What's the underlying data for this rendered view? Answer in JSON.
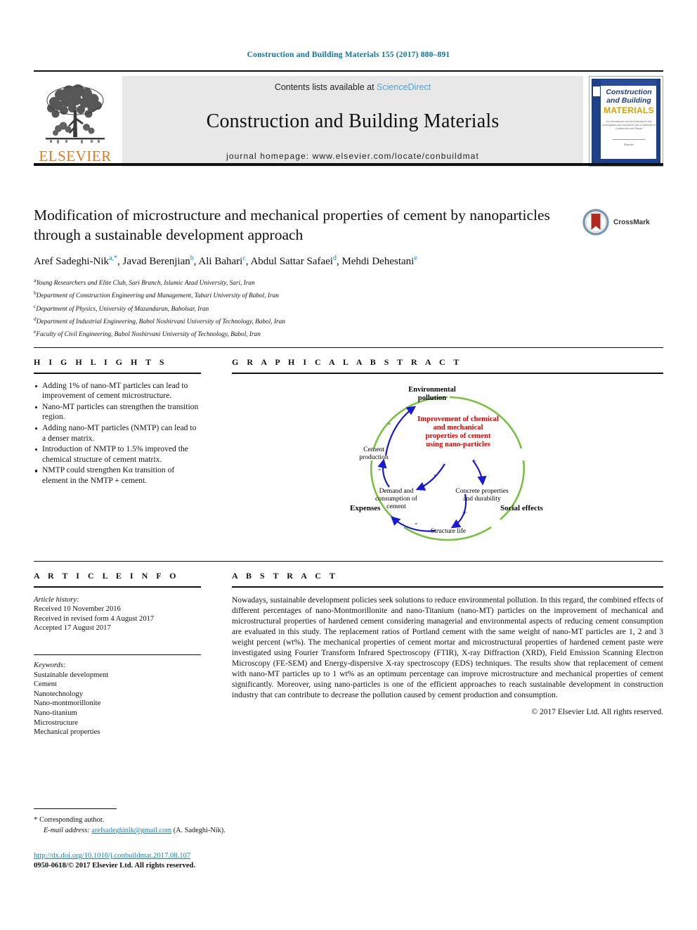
{
  "running_head": "Construction and Building Materials 155 (2017) 880–891",
  "masthead": {
    "elsevier_wordmark": "ELSEVIER",
    "contents_prefix": "Contents lists available at ",
    "sciencedirect": "ScienceDirect",
    "journal_title": "Construction and Building Materials",
    "homepage": "journal homepage: www.elsevier.com/locate/conbuildmat",
    "cover": {
      "line1": "Construction",
      "line2": "and Building",
      "line3": "MATERIALS",
      "blurb": "An International Journal Dedicated to the Investigation and Innovative Use of Materials in Construction and Repair",
      "foot": "Elsevier"
    }
  },
  "article": {
    "title": "Modification of microstructure and mechanical properties of cement by nanoparticles through a sustainable development approach",
    "authors": [
      {
        "name": "Aref Sadeghi-Nik",
        "marks": "a,*"
      },
      {
        "name": "Javad Berenjian",
        "marks": "b"
      },
      {
        "name": "Ali Bahari",
        "marks": "c"
      },
      {
        "name": "Abdul Sattar Safaei",
        "marks": "d"
      },
      {
        "name": "Mehdi Dehestani",
        "marks": "e"
      }
    ],
    "affiliations": [
      {
        "mark": "a",
        "text": "Young Researchers and Elite Club, Sari Branch, Islamic Azad University, Sari, Iran"
      },
      {
        "mark": "b",
        "text": "Department of Construction Engineering and Management, Tabari University of Babol, Iran"
      },
      {
        "mark": "c",
        "text": "Department of Physics, University of Mazandaran, Babolsar, Iran"
      },
      {
        "mark": "d",
        "text": "Department of Industrial Engineering, Babol Noshirvani University of Technology, Babol, Iran"
      },
      {
        "mark": "e",
        "text": "Faculty of Civil Engineering, Babol Noshirvani University of Technology, Babol, Iran"
      }
    ],
    "crossmark_label": "CrossMark"
  },
  "highlights": {
    "heading": "H I G H L I G H T S",
    "items": [
      "Adding 1% of nano-MT particles can lead to improvement of cement microstructure.",
      "Nano-MT particles can strengthen the transition region.",
      "Adding nano-MT particles (NMTP) can lead to a denser matrix.",
      "Introduction of NMTP to 1.5% improved the chemical structure of cement matrix.",
      "NMTP could strengthen Kα transition of element in the NMTP + cement."
    ]
  },
  "graphical_abstract": {
    "heading": "G R A P H I C A L   A B S T R A C T",
    "center_text": [
      "Improvement of chemical",
      "and mechanical",
      "properties of cement",
      "using nano-particles"
    ],
    "nodes": {
      "top": "Environmental pollution",
      "left": "Expenses",
      "right": "Social effects",
      "cement_production": "Cement production",
      "demand": "Demand and consumption of cement",
      "concrete": "Concrete properties and durability",
      "structure_life": "Structure life"
    },
    "polarity_marks": [
      "-",
      "-",
      "-",
      "+",
      "+",
      "-"
    ],
    "colors": {
      "ring": "#7ac143",
      "arrow": "#1a1ad0",
      "center": "#e60000"
    }
  },
  "article_info": {
    "heading": "A R T I C L E   I N F O",
    "history_label": "Article history:",
    "history": [
      "Received 10 November 2016",
      "Received in revised form 4 August 2017",
      "Accepted 17 August 2017"
    ],
    "keywords_label": "Keywords:",
    "keywords": [
      "Sustainable development",
      "Cement",
      "Nanotechnology",
      "Nano-montmorillonite",
      "Nano-titanium",
      "Microstructure",
      "Mechanical properties"
    ]
  },
  "abstract": {
    "heading": "A B S T R A C T",
    "body": "Nowadays, sustainable development policies seek solutions to reduce environmental pollution. In this regard, the combined effects of different percentages of nano-Montmorillonite and nano-Titanium (nano-MT) particles on the improvement of mechanical and microstructural properties of hardened cement considering managerial and environmental aspects of reducing cement consumption are evaluated in this study. The replacement ratios of Portland cement with the same weight of nano-MT particles are 1, 2 and 3 weight percent (wt%). The mechanical properties of cement mortar and microstructural properties of hardened cement paste were investigated using Fourier Transform Infrared Spectroscopy (FTIR), X-ray Diffraction (XRD), Field Emission Scanning Electron Microscopy (FE-SEM) and Energy-dispersive X-ray spectroscopy (EDS) techniques. The results show that replacement of cement with nano-MT particles up to 1 wt% as an optimum percentage can improve microstructure and mechanical properties of cement significantly. Moreover, using nano-particles is one of the efficient approaches to reach sustainable development in construction industry that can contribute to decrease the pollution caused by cement production and consumption.",
    "copyright": "© 2017 Elsevier Ltd. All rights reserved."
  },
  "footer": {
    "corresponding": "Corresponding author.",
    "email_label": "E-mail address:",
    "email": "arefsadeghinik@gmail.com",
    "email_owner": "(A. Sadeghi-Nik).",
    "doi": "http://dx.doi.org/10.1016/j.conbuildmat.2017.08.107",
    "issn": "0950-0618/© 2017 Elsevier Ltd. All rights reserved."
  }
}
